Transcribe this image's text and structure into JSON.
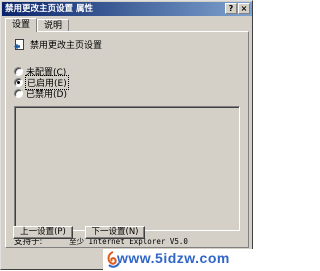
{
  "window": {
    "title": "禁用更改主页设置 属性",
    "help_btn": "?",
    "close_btn": "×"
  },
  "tabs": [
    {
      "label": "设置",
      "active": true
    },
    {
      "label": "说明",
      "active": false
    }
  ],
  "policy": {
    "name": "禁用更改主页设置",
    "icon": "policy-document-icon"
  },
  "options": [
    {
      "label": "未配置(C)",
      "selected": false
    },
    {
      "label": "已启用(E)",
      "selected": true
    },
    {
      "label": "已禁用(D)",
      "selected": false
    }
  ],
  "supported": {
    "label": "支持于:",
    "value": "至少 Internet Explorer V5.0"
  },
  "buttons": {
    "prev": "上一设置(P)",
    "next": "下一设置(N)"
  },
  "watermark": {
    "text": "www.5idzw.com"
  },
  "colors": {
    "titlebar_start": "#0a246a",
    "titlebar_end": "#7da2ce",
    "face": "#d4d0c8",
    "watermark": "#2f66c8"
  }
}
